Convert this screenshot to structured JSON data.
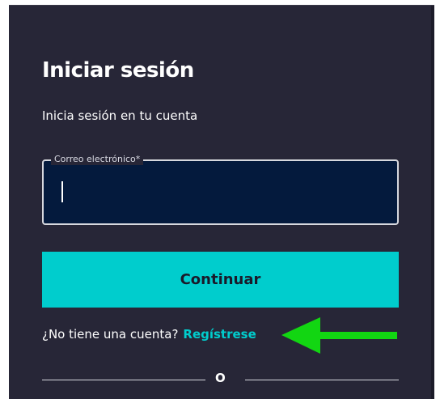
{
  "login": {
    "title": "Iniciar sesión",
    "subtitle": "Inicia sesión en tu cuenta",
    "email_label": "Correo electrónico*",
    "email_value": "",
    "continue_label": "Continuar",
    "signup_prompt": "¿No tiene una cuenta?",
    "signup_link": "Regístrese",
    "divider_text": "O"
  },
  "annotation": {
    "arrow_icon": "green-arrow-left",
    "arrow_color": "#12d612"
  },
  "colors": {
    "background": "#272637",
    "accent": "#00cdcd",
    "input_bg": "#041a3d"
  }
}
